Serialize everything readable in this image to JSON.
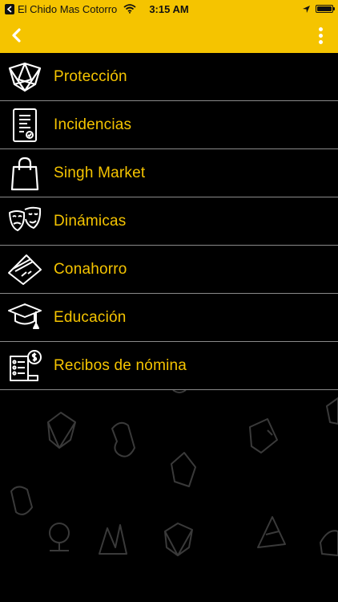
{
  "status_bar": {
    "carrier": "El Chido Mas Cotorro",
    "time": "3:15 AM",
    "battery_level": 1.0,
    "icons": [
      "back-to-app-icon",
      "wifi-icon",
      "location-arrow-icon",
      "battery-icon"
    ]
  },
  "app_bar": {
    "background": "#f5c400",
    "back_icon": "chevron-left-icon",
    "overflow_icon": "kebab-menu-icon"
  },
  "menu": {
    "label_color": "#f5c400",
    "items": [
      {
        "label": "Protección",
        "icon": "shield-outline-icon"
      },
      {
        "label": "Incidencias",
        "icon": "document-check-icon"
      },
      {
        "label": "Singh Market",
        "icon": "shopping-bag-icon"
      },
      {
        "label": "Dinámicas",
        "icon": "theater-masks-icon"
      },
      {
        "label": "Conahorro",
        "icon": "credit-card-icon"
      },
      {
        "label": "Educación",
        "icon": "graduation-cap-icon"
      },
      {
        "label": "Recibos de nómina",
        "icon": "payroll-receipt-icon"
      }
    ]
  }
}
